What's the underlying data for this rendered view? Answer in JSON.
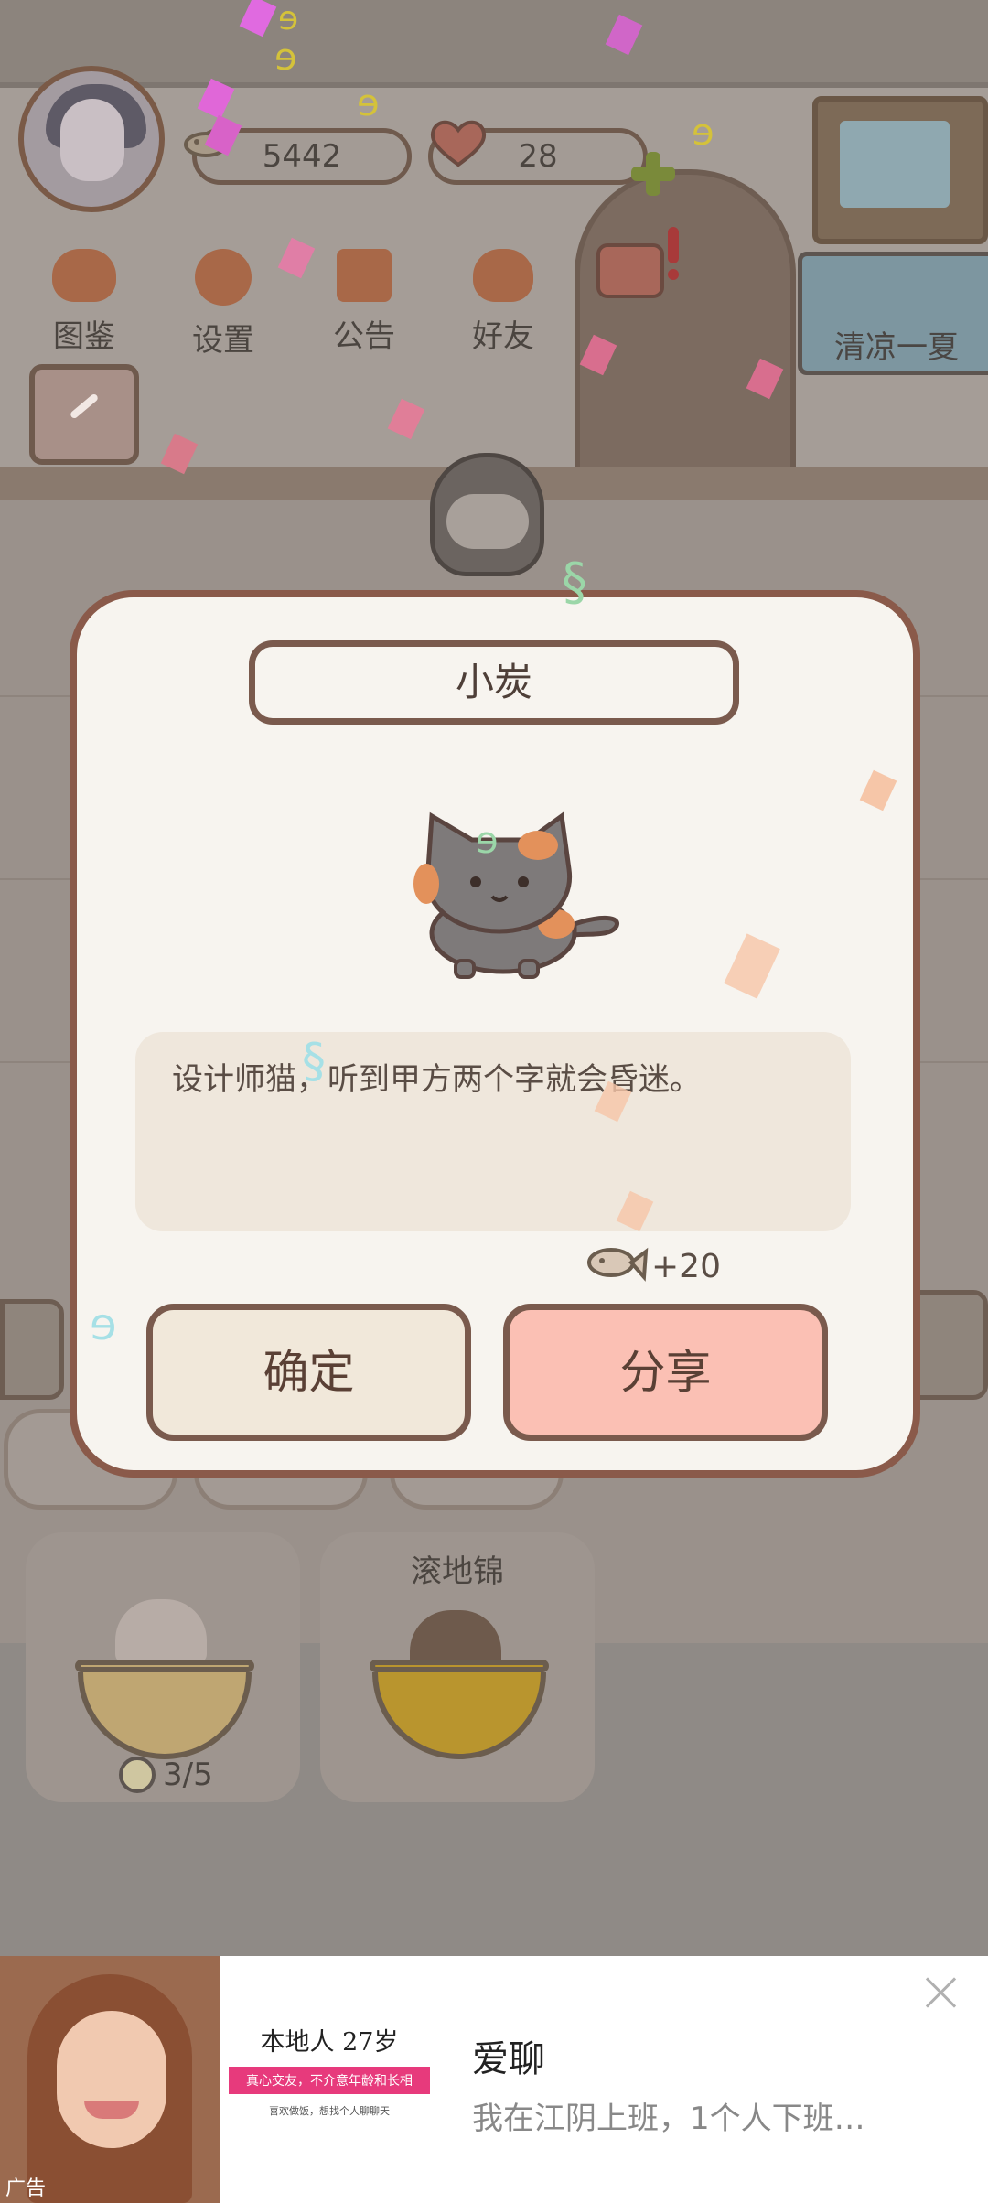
{
  "header": {
    "fish_count": "5442",
    "heart_count": "28"
  },
  "menu": {
    "items": [
      {
        "label": "图鉴",
        "icon": "cat-book-icon"
      },
      {
        "label": "设置",
        "icon": "gear-icon"
      },
      {
        "label": "公告",
        "icon": "gift-icon"
      },
      {
        "label": "好友",
        "icon": "friends-icon"
      }
    ]
  },
  "event_banner": {
    "label": "清凉一夏"
  },
  "modal": {
    "cat_name": "小炭",
    "description": "设计师猫，听到甲方两个字就会昏迷。",
    "reward": "+20",
    "confirm_label": "确定",
    "share_label": "分享"
  },
  "bowls": [
    {
      "name": "",
      "count": "3/5"
    },
    {
      "name": "滚地锦",
      "count": ""
    }
  ],
  "ad": {
    "tag": "广告",
    "card_title": "本地人  27岁",
    "card_pink": "真心交友，不介意年龄和长相",
    "card_sub": "喜欢做饭，想找个人聊聊天",
    "title": "爱聊",
    "description": "我在江阴上班，1个人下班…"
  },
  "colors": {
    "modal_border": "#8a5a4a",
    "share_button": "#fbc0b4",
    "confirm_button": "#f1e8da"
  }
}
